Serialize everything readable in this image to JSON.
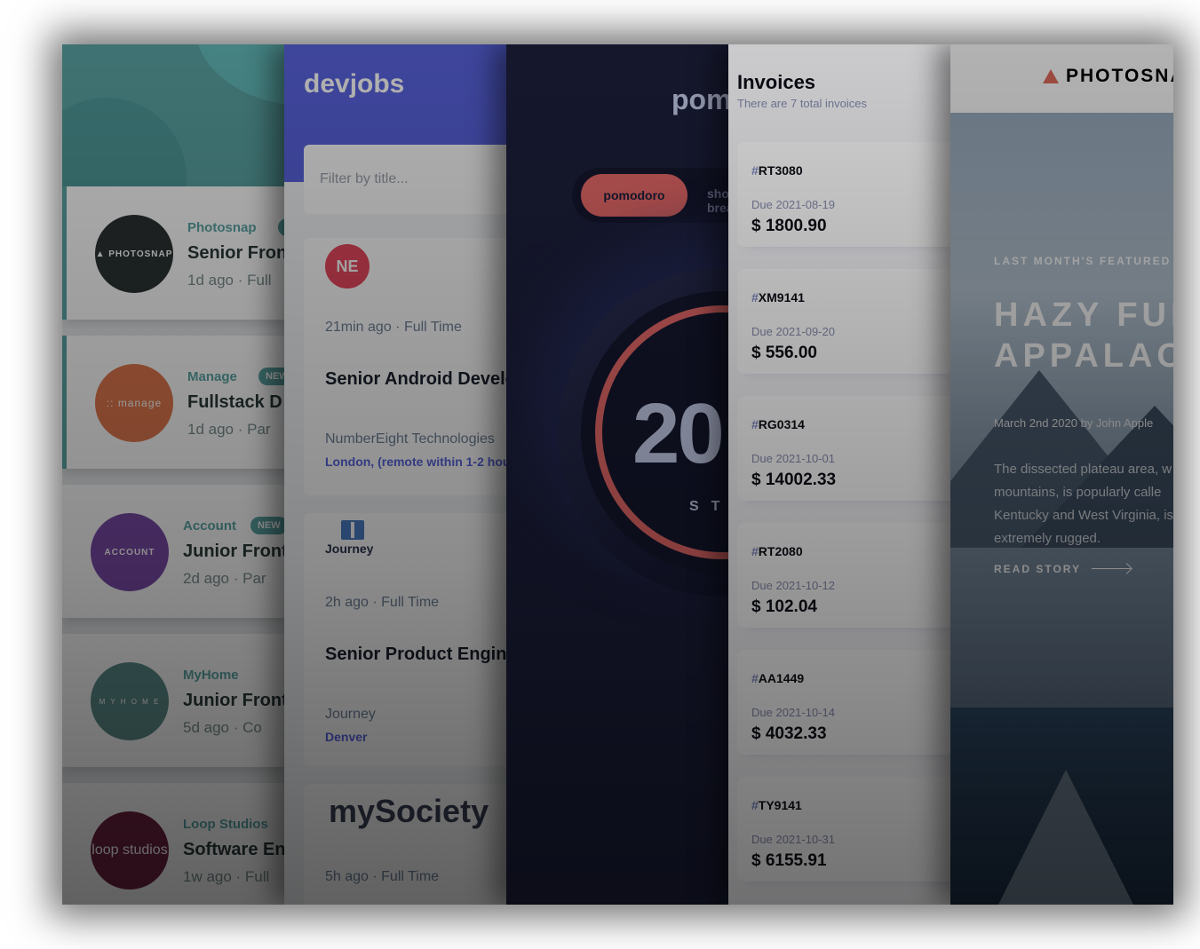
{
  "panel1": {
    "jobs": [
      {
        "logo_text": "▲ PHOTOSNAP",
        "logo_color": "#5ba4a4",
        "logo_bg": "#3a4444",
        "company": "Photosnap",
        "badge": "N",
        "position": "Senior Fron",
        "meta": "1d ago  ·  Full"
      },
      {
        "logo_text": ":: manage",
        "logo_bg": "#e0784e",
        "company": "Manage",
        "badge": "NEW",
        "position": "Fullstack D",
        "meta": "1d ago  ·  Par"
      },
      {
        "logo_text": "ACCOUNT",
        "logo_bg": "#7a4aa8",
        "company": "Account",
        "badge": "NEW",
        "position": "Junior Front",
        "meta": "2d ago  ·  Par"
      },
      {
        "logo_text": "M Y H O M E",
        "logo_bg": "#5b8c8a",
        "company": "MyHome",
        "badge": "",
        "position": "Junior Front",
        "meta": "5d ago  ·  Co"
      },
      {
        "logo_text": "loop studios",
        "logo_bg": "#6c2240",
        "company": "Loop Studios",
        "badge": "",
        "position": "Software En",
        "meta": "1w ago  ·  Full"
      }
    ]
  },
  "panel2": {
    "brand": "devjobs",
    "filter_placeholder": "Filter by title...",
    "jobs": [
      {
        "logo": "NE",
        "meta": "21min ago  ·  Full Time",
        "title": "Senior Android Develo",
        "company": "NumberEight Technologies",
        "location": "London, (remote within 1-2 hou"
      },
      {
        "logo": "Journey",
        "meta": "2h ago  ·  Full Time",
        "title": "Senior Product Engine",
        "company": "Journey",
        "location": "Denver"
      },
      {
        "logo": "mySociety",
        "meta": "5h ago  ·  Full Time"
      }
    ]
  },
  "panel3": {
    "brand": "pomodoro",
    "tabs": [
      "pomodoro",
      "short break"
    ],
    "time": "20",
    "status": "START",
    "accent": "#f87070"
  },
  "panel4": {
    "title": "Invoices",
    "subtitle": "There are 7 total invoices",
    "invoices": [
      {
        "id": "RT3080",
        "due": "Due 2021-08-19",
        "amount": "$ 1800.90"
      },
      {
        "id": "XM9141",
        "due": "Due 2021-09-20",
        "amount": "$ 556.00"
      },
      {
        "id": "RG0314",
        "due": "Due 2021-10-01",
        "amount": "$ 14002.33"
      },
      {
        "id": "RT2080",
        "due": "Due 2021-10-12",
        "amount": "$ 102.04"
      },
      {
        "id": "AA1449",
        "due": "Due 2021-10-14",
        "amount": "$ 4032.33"
      },
      {
        "id": "TY9141",
        "due": "Due 2021-10-31",
        "amount": "$ 6155.91"
      }
    ]
  },
  "panel5": {
    "logo": "PHOTOSNAP",
    "label": "LAST MONTH'S FEATURED S",
    "title_line1": "HAZY FUL",
    "title_line2": "APPALAC",
    "date": "March 2nd 2020   by John Apple",
    "desc": "The dissected plateau area, w mountains, is popularly calle Kentucky and West Virginia, is extremely rugged.",
    "read": "READ STORY"
  }
}
